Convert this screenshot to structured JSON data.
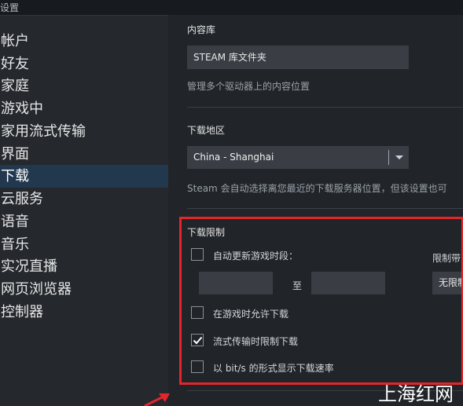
{
  "window": {
    "title": "设置"
  },
  "sidebar": {
    "items": [
      {
        "label": "帐户"
      },
      {
        "label": "好友"
      },
      {
        "label": "家庭"
      },
      {
        "label": "游戏中"
      },
      {
        "label": "家用流式传输"
      },
      {
        "label": "界面"
      },
      {
        "label": "下载",
        "active": true
      },
      {
        "label": "云服务"
      },
      {
        "label": "语音"
      },
      {
        "label": "音乐"
      },
      {
        "label": "实况直播"
      },
      {
        "label": "网页浏览器"
      },
      {
        "label": "控制器"
      }
    ]
  },
  "content_library": {
    "title": "内容库",
    "button_label": "STEAM 库文件夹",
    "description": "管理多个驱动器上的内容位置"
  },
  "download_region": {
    "title": "下载地区",
    "selected": "China - Shanghai",
    "description": "Steam 会自动选择离您最近的下载服务器位置，但该设置也可"
  },
  "download_limits": {
    "title": "下载限制",
    "auto_update_label": "自动更新游戏时段：",
    "auto_update_checked": false,
    "time_from": "",
    "to_label": "至",
    "time_to": "",
    "bandwidth_label": "限制带",
    "bandwidth_value": "无限制",
    "allow_ingame_label": "在游戏时允许下载",
    "allow_ingame_checked": false,
    "throttle_streaming_label": "流式传输时限制下载",
    "throttle_streaming_checked": true,
    "bits_label": "以 bit/s 的形式显示下载速率",
    "bits_checked": false
  },
  "colors": {
    "highlight_border": "#e2262a",
    "active_item_bg": "#21384f",
    "panel_bg": "#212428",
    "sidebar_bg": "#25282d"
  },
  "watermark": "上海红网"
}
